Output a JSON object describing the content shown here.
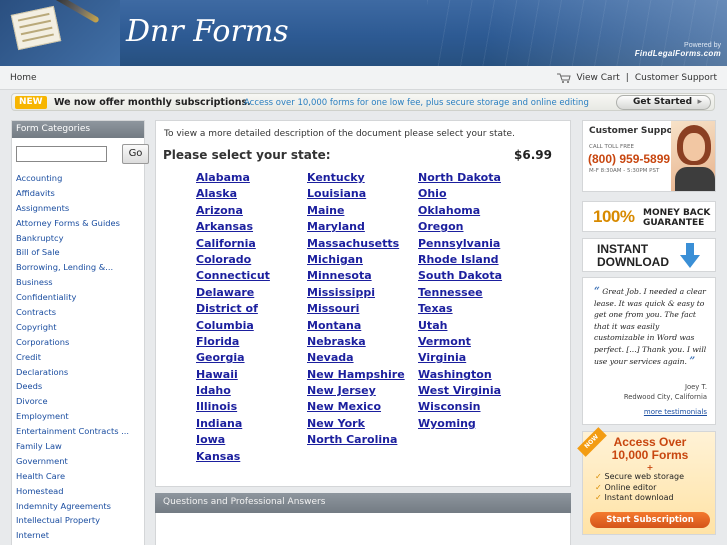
{
  "header": {
    "site_title": "Dnr Forms",
    "powered_label": "Powered by",
    "powered_brand": "FindLegalForms.com"
  },
  "nav": {
    "home": "Home",
    "view_cart": "View Cart",
    "separator": "|",
    "customer_support": "Customer Support"
  },
  "promo": {
    "badge": "NEW",
    "headline": "We now offer monthly subscriptions.",
    "sub": "Access over 10,000 forms for one low fee, plus secure storage and online editing",
    "button": "Get Started"
  },
  "sidebar": {
    "heading": "Form Categories",
    "search_placeholder": "",
    "go_label": "Go",
    "categories": [
      "Accounting",
      "Affidavits",
      "Assignments",
      "Attorney Forms & Guides",
      "Bankruptcy",
      "Bill of Sale",
      "Borrowing, Lending &...",
      "Business",
      "Confidentiality",
      "Contracts",
      "Copyright",
      "Corporations",
      "Credit",
      "Declarations",
      "Deeds",
      "Divorce",
      "Employment",
      "Entertainment Contracts ...",
      "Family Law",
      "Government",
      "Health Care",
      "Homestead",
      "Indemnity Agreements",
      "Intellectual Property",
      "Internet"
    ]
  },
  "main": {
    "intro": "To view a more detailed description of the document please select your state.",
    "select_label": "Please select your state:",
    "price": "$6.99",
    "states_col1": [
      "Alabama",
      "Alaska",
      "Arizona",
      "Arkansas",
      "California",
      "Colorado",
      "Connecticut",
      "Delaware",
      "District of",
      "Columbia",
      "Florida",
      "Georgia",
      "Hawaii",
      "Idaho",
      "Illinois",
      "Indiana",
      "Iowa",
      "Kansas"
    ],
    "states_col2": [
      "Kentucky",
      "Louisiana",
      "Maine",
      "Maryland",
      "Massachusetts",
      "Michigan",
      "Minnesota",
      "Mississippi",
      "Missouri",
      "Montana",
      "Nebraska",
      "Nevada",
      "New Hampshire",
      "New Jersey",
      "New Mexico",
      "New York",
      "North Carolina"
    ],
    "states_col3": [
      "North Dakota",
      "Ohio",
      "Oklahoma",
      "Oregon",
      "Pennsylvania",
      "Rhode Island",
      "South Dakota",
      "Tennessee",
      "Texas",
      "Utah",
      "Vermont",
      "Virginia",
      "Washington",
      "West Virginia",
      "Wisconsin",
      "Wyoming"
    ],
    "qa_heading": "Questions and Professional Answers"
  },
  "right": {
    "support_title": "Customer Support",
    "toll_free": "CALL TOLL FREE",
    "phone": "(800) 959-5899",
    "hours": "M-F 8:30AM - 5:30PM PST",
    "money_back_num": "100%",
    "money_back_l1": "MONEY BACK",
    "money_back_l2": "GUARANTEE",
    "instant_l1": "INSTANT",
    "instant_l2": "DOWNLOAD",
    "testimonial": "Great Job. I needed a clear lease. It was quick & easy to get one from you. The fact that it was easily customizable in Word was perfect. [...] Thank you. I will use your services again.",
    "author_name": "Joey T.",
    "author_loc": "Redwood City, California",
    "more_testimonials": "more testimonials",
    "access_now": "NOW",
    "access_l1": "Access Over",
    "access_l2": "10,000 Forms",
    "access_plus": "+",
    "access_features": [
      "Secure web storage",
      "Online editor",
      "Instant download"
    ],
    "start_sub": "Start Subscription"
  },
  "colors": {
    "header_blue": "#2d5a93",
    "link_blue": "#1b1f9e",
    "accent_orange": "#c8460f",
    "badge_yellow": "#f7b500"
  }
}
